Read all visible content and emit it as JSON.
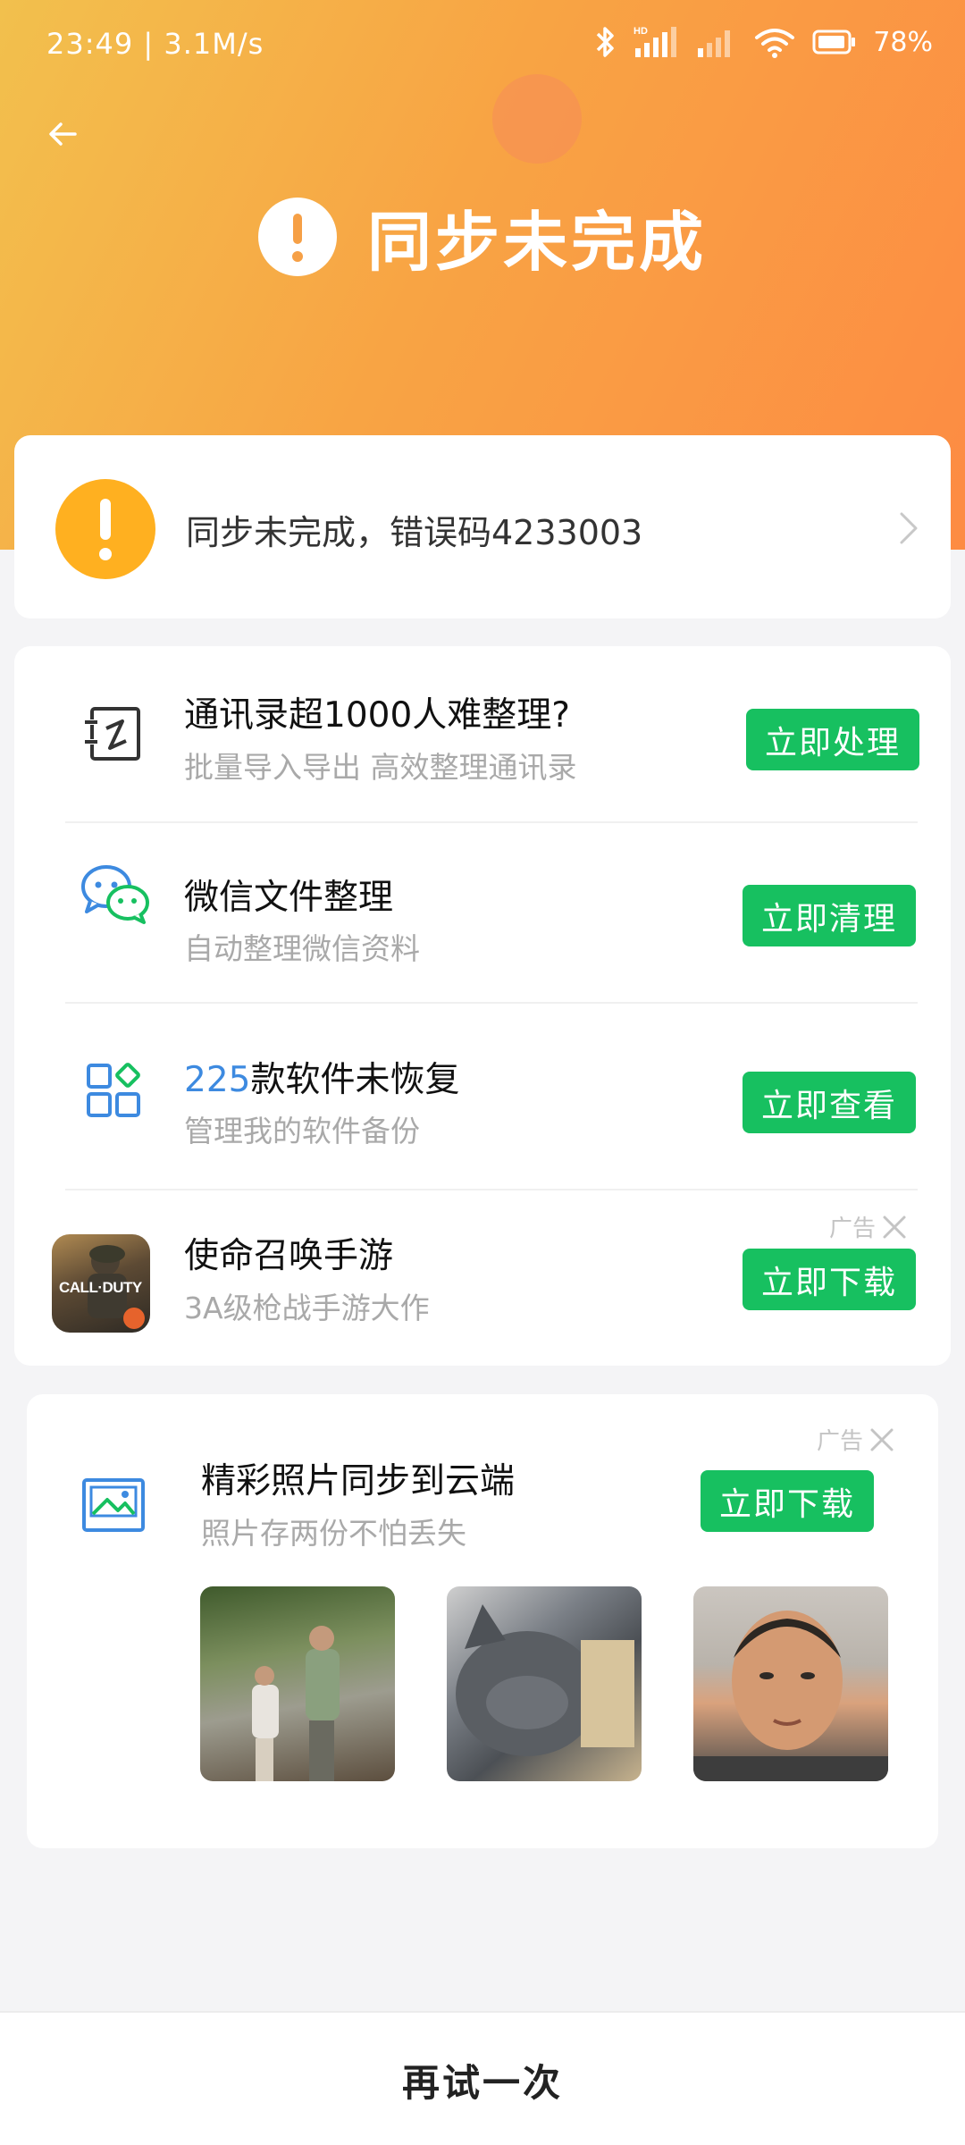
{
  "status_bar": {
    "time_speed": "23:49 | 3.1M/s",
    "battery": "78%"
  },
  "header": {
    "title": "同步未完成",
    "gradient_colors": [
      "#f2c04d",
      "#fd8b43"
    ]
  },
  "error_card": {
    "text": "同步未完成，错误码4233003",
    "icon": "warning-icon",
    "color": "#ffb020"
  },
  "features": [
    {
      "title": "通讯录超1000人难整理?",
      "subtitle": "批量导入导出 高效整理通讯录",
      "button": "立即处理",
      "icon": "contacts-edit-icon"
    },
    {
      "title": "微信文件整理",
      "subtitle": "自动整理微信资料",
      "button": "立即清理",
      "icon": "wechat-icon"
    },
    {
      "title_highlight": "225",
      "title_rest": "款软件未恢复",
      "subtitle": "管理我的软件备份",
      "button": "立即查看",
      "icon": "apps-grid-icon"
    },
    {
      "title": "使命召唤手游",
      "subtitle": "3A级枪战手游大作",
      "button": "立即下载",
      "ad_label": "广告",
      "icon": "call-of-duty-game-icon",
      "icon_text": "CALL·DUTY"
    }
  ],
  "photo_card": {
    "ad_label": "广告",
    "title": "精彩照片同步到云端",
    "subtitle": "照片存两份不怕丢失",
    "button": "立即下载",
    "icon": "gallery-icon"
  },
  "bottom": {
    "retry_label": "再试一次"
  },
  "accent_green": "#17c060"
}
